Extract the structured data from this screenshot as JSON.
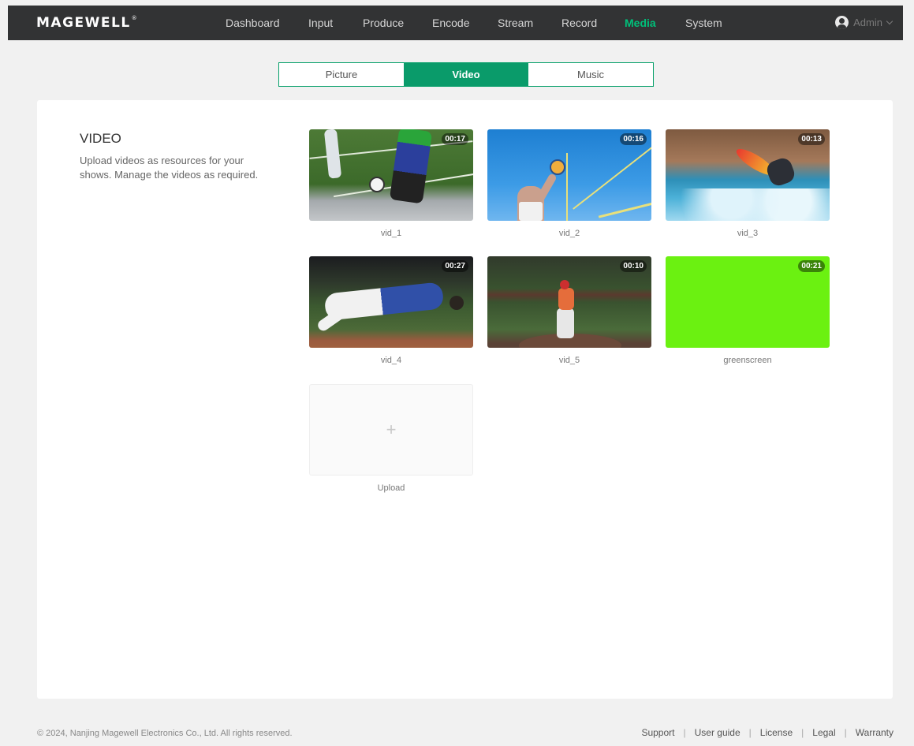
{
  "brand": {
    "name": "MAGEWELL",
    "mark": "®"
  },
  "nav": {
    "items": [
      {
        "label": "Dashboard"
      },
      {
        "label": "Input"
      },
      {
        "label": "Produce"
      },
      {
        "label": "Encode"
      },
      {
        "label": "Stream"
      },
      {
        "label": "Record"
      },
      {
        "label": "Media",
        "active": true
      },
      {
        "label": "System"
      }
    ],
    "user": "Admin"
  },
  "tabs": [
    {
      "label": "Picture"
    },
    {
      "label": "Video",
      "active": true
    },
    {
      "label": "Music"
    }
  ],
  "section": {
    "title": "VIDEO",
    "description": "Upload videos as resources for your shows. Manage the videos as required."
  },
  "videos": [
    {
      "name": "vid_1",
      "duration": "00:17"
    },
    {
      "name": "vid_2",
      "duration": "00:16"
    },
    {
      "name": "vid_3",
      "duration": "00:13"
    },
    {
      "name": "vid_4",
      "duration": "00:27"
    },
    {
      "name": "vid_5",
      "duration": "00:10"
    },
    {
      "name": "greenscreen",
      "duration": "00:21"
    }
  ],
  "upload": {
    "label": "Upload",
    "icon": "plus-icon"
  },
  "footer": {
    "copyright": "© 2024, Nanjing Magewell Electronics Co., Ltd. All rights reserved.",
    "links": [
      "Support",
      "User guide",
      "License",
      "Legal",
      "Warranty"
    ]
  },
  "colors": {
    "accent": "#0a9b6a",
    "active_nav": "#00c07a",
    "topbar": "#323334",
    "greenscreen": "#6bf111"
  }
}
